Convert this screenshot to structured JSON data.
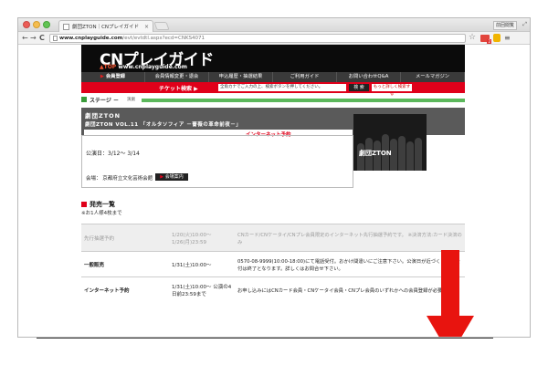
{
  "browser": {
    "tab_title": "劇団ZTON｜CNプレイガイド",
    "tab_close": "×",
    "top_right_button": "前回閲覧",
    "url_bold": "www.cnplayguide.com",
    "url_rest": "/evt/evtdtl.aspx?ecd=CNKS4071",
    "back": "←",
    "forward": "→",
    "reload": "C",
    "star": "☆",
    "ext_badge": "2",
    "menu": "≡"
  },
  "site": {
    "logo": "CNプレイガイド",
    "logo_top": "▲TOP",
    "logo_url": "www.cnplayguide.com",
    "menu": {
      "register_mark": "▶",
      "register": "会員登録",
      "items": [
        "会員情報変更・退会",
        "申込履歴・抽選結果",
        "ご利用ガイド",
        "お問い合わせQ&A",
        "メールマガジン"
      ]
    },
    "search": {
      "label": "チケット検索",
      "placeholder": "全角カナでご入力の上、検索ボタンを押してください。",
      "button": "検 索",
      "more": "もっと詳しく検索する"
    },
    "stage": {
      "title": "ステージ",
      "dash": "－",
      "sub": "演劇"
    },
    "event": {
      "troupe": "劇団ZTON",
      "title": "劇団ZTON VOL.11 「オルタソフィア －薔薇の革命前夜－」",
      "internet": "インターネット予約",
      "photo_label": "劇団ZTON"
    },
    "info": {
      "period": "公演日：3/12～ 3/14",
      "venue": "会場： 京都府立文化芸術会館",
      "venue_button_mark": "▶",
      "venue_button": "会場案内"
    },
    "sales": {
      "heading": "発売一覧",
      "note": "※お1人様4枚まで",
      "rows": [
        {
          "name": "先行抽選予約",
          "date": "1/20(火)10:00～ 1/26(月)23:59",
          "desc": "CNカード/CNケータイ/CNプレ会員限定のインターネット先行抽選予約です。 ※決済方法:カード決済のみ"
        },
        {
          "name": "一般販売",
          "date": "1/31(土)10:00～",
          "desc": "0570-08-9999(10:00-18:00)にて電話受付。おかけ間違いにご注意下さい。公演日が近づくと電話受付は終了となります。詳しくはお問合せ下さい。"
        },
        {
          "name": "インターネット予約",
          "date": "1/31(土)10:00～ 公演の4日前23:59まで",
          "desc": "お申し込みにはCNカード会員・CNケータイ会員・CNプレ会員のいずれかへの会員登録が必要です。"
        }
      ]
    }
  },
  "colors": {
    "brand_red": "#e0001a",
    "menu_dark": "#3a3a3a",
    "stage_green": "#5cb85c",
    "arrow_red": "#e8140f"
  }
}
